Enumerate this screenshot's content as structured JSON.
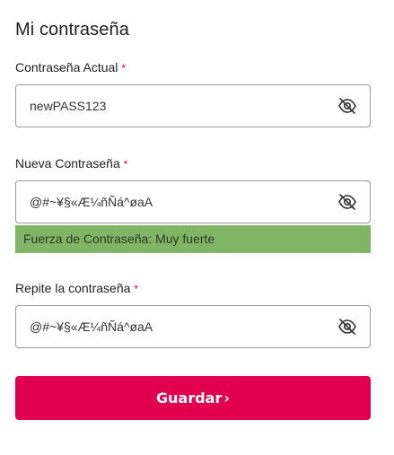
{
  "page": {
    "title": "Mi contraseña"
  },
  "current_password": {
    "label": "Contraseña Actual",
    "required_mark": "*",
    "value": "newPASS123",
    "toggle_icon": "eye-slash-icon"
  },
  "new_password": {
    "label": "Nueva Contraseña",
    "required_mark": "*",
    "value": "@#~¥§«Æ¼ñÑá^øaA",
    "toggle_icon": "eye-slash-icon",
    "strength_text": "Fuerza de Contraseña: Muy fuerte",
    "strength_color": "#7fb565"
  },
  "repeat_password": {
    "label": "Repite la contraseña",
    "required_mark": "*",
    "value": "@#~¥§«Æ¼ñÑá^øaA",
    "toggle_icon": "eye-slash-icon"
  },
  "actions": {
    "save_label": "Guardar",
    "save_chevron": "›",
    "accent_color": "#e0004d"
  }
}
